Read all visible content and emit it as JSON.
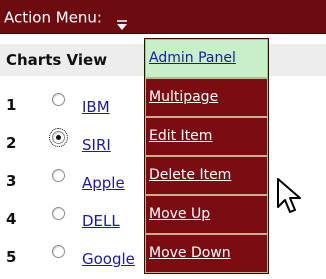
{
  "action_bar": {
    "label": "Action Menu:",
    "icon": "dropdown-arrow-icon"
  },
  "charts": {
    "header": "Charts View"
  },
  "rows": [
    {
      "num": "1",
      "link": "IBM",
      "checked": false
    },
    {
      "num": "2",
      "link": "SIRI",
      "checked": true
    },
    {
      "num": "3",
      "link": "Apple",
      "checked": false
    },
    {
      "num": "4",
      "link": "DELL",
      "checked": false
    },
    {
      "num": "5",
      "link": "Google",
      "checked": false
    }
  ],
  "menu": {
    "items": [
      {
        "label": "Admin Panel",
        "active": true
      },
      {
        "label": "Multipage",
        "active": false
      },
      {
        "label": "Edit Item",
        "active": false
      },
      {
        "label": "Delete Item",
        "active": false
      },
      {
        "label": "Move Up",
        "active": false
      },
      {
        "label": "Move Down",
        "active": false
      }
    ]
  },
  "colors": {
    "menu_bg": "#7b0d12",
    "menu_active_bg": "#c8f0c8",
    "header_bg": "#6d0c10",
    "link": "#1a1aa6"
  }
}
